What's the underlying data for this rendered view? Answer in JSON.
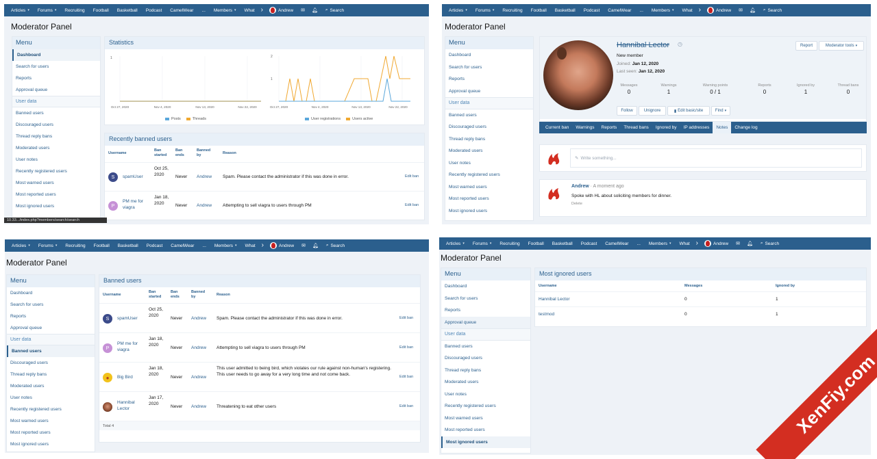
{
  "nav": {
    "items": [
      "Articles",
      "Forums",
      "Recruiting",
      "Football",
      "Basketball",
      "Podcast",
      "CamelWear"
    ],
    "members": "Members",
    "whats_new": "What",
    "user": "Andrew",
    "search": "Search",
    "tl_whats_new": "What"
  },
  "page_title": "Moderator Panel",
  "menu": {
    "header": "Menu",
    "top": [
      "Dashboard",
      "Search for users",
      "Reports",
      "Approval queue"
    ],
    "section": "User data",
    "items": [
      "Banned users",
      "Discouraged users",
      "Thread reply bans",
      "Moderated users",
      "User notes",
      "Recently registered users",
      "Most warned users",
      "Most reported users",
      "Most ignored users"
    ]
  },
  "tl": {
    "statistics": "Statistics",
    "chart1": {
      "ymax": "1",
      "xticks": [
        "Oct 27, 2020",
        "Nov 4, 2020",
        "Nov 13, 2020",
        "Nov 22, 2020"
      ],
      "legend": [
        "Posts",
        "Threads"
      ]
    },
    "chart2": {
      "yticks": [
        "2",
        "1"
      ],
      "xticks": [
        "Oct 27, 2020",
        "Nov 4, 2020",
        "Nov 13, 2020",
        "Nov 22, 2020"
      ],
      "legend": [
        "User registrations",
        "Users active"
      ]
    },
    "recently_banned": "Recently banned users",
    "cols": [
      "Username",
      "Ban started",
      "Ban ends",
      "Banned by",
      "Reason"
    ],
    "rows": [
      {
        "initial": "S",
        "user": "spamUser",
        "start": "Oct 25, 2020",
        "ends": "Never",
        "by": "Andrew",
        "reason": "Spam. Please contact the administrator if this was done in error.",
        "edit": "Edit ban"
      },
      {
        "initial": "P",
        "user": "PM me for viagra",
        "start": "Jan 18, 2020",
        "ends": "Never",
        "by": "Andrew",
        "reason": "Attempting to sell viagra to users through PM",
        "edit": "Edit ban"
      }
    ],
    "status_url": "10.33.../index.php?members/search/search"
  },
  "tr": {
    "name": "Hannibal Lector",
    "role": "New member",
    "joined_label": "Joined:",
    "joined": "Jan 12, 2020",
    "last_seen_label": "Last seen:",
    "last_seen": "Jan 12, 2020",
    "report": "Report",
    "mod_tools": "Moderator tools",
    "stats": [
      {
        "label": "Messages",
        "value": "0"
      },
      {
        "label": "Warnings",
        "value": "1"
      },
      {
        "label": "Warning points",
        "value": "0 / 1"
      },
      {
        "label": "Reports",
        "value": "0"
      },
      {
        "label": "Ignored by",
        "value": "1"
      },
      {
        "label": "Thread bans",
        "value": "0"
      }
    ],
    "follow": "Follow",
    "unignore": "Unignore",
    "edit_basic": "Edit basic/site",
    "find": "Find",
    "tabs": [
      "Current ban",
      "Warnings",
      "Reports",
      "Thread bans",
      "Ignored by",
      "IP addresses",
      "Notes",
      "Change log"
    ],
    "write_placeholder": "Write something...",
    "note_author": "Andrew",
    "note_time": "A moment ago",
    "note_text": "Spoke with HL about soliciting members for dinner.",
    "note_delete": "Delete"
  },
  "bl": {
    "header": "Banned users",
    "cols": [
      "Username",
      "Ban started",
      "Ban ends",
      "Banned by",
      "Reason"
    ],
    "rows": [
      {
        "initial": "S",
        "user": "spamUser",
        "start": "Oct 25, 2020",
        "ends": "Never",
        "by": "Andrew",
        "reason": "Spam. Please contact the administrator if this was done in error.",
        "edit": "Edit ban"
      },
      {
        "initial": "P",
        "user": "PM me for viagra",
        "start": "Jan 18, 2020",
        "ends": "Never",
        "by": "Andrew",
        "reason": "Attempting to sell viagra to users through PM",
        "edit": "Edit ban"
      },
      {
        "initial": "",
        "user": "Big Bird",
        "start": "Jan 18, 2020",
        "ends": "Never",
        "by": "Andrew",
        "reason": "This user admitted to being bird, which violates our rule against non-human's registering. This user needs to go away for a very long time and not come back.",
        "edit": "Edit ban"
      },
      {
        "initial": "",
        "user": "Hannibal Lector",
        "start": "Jan 17, 2020",
        "ends": "Never",
        "by": "Andrew",
        "reason": "Threatening to eat other users",
        "edit": "Edit ban"
      }
    ],
    "total": "Total 4"
  },
  "br": {
    "header": "Most ignored users",
    "cols": [
      "Username",
      "Messages",
      "Ignored by"
    ],
    "rows": [
      {
        "user": "Hannibal Lector",
        "messages": "0",
        "ignored": "1"
      },
      {
        "user": "testmod",
        "messages": "0",
        "ignored": "1"
      }
    ]
  },
  "watermark": "XenFiy.com",
  "colors": {
    "nav": "#2b5f8d",
    "accent": "#4f86b6",
    "series_blue": "#5aa7db",
    "series_orange": "#f0a830",
    "brand_red": "#d32e21"
  }
}
